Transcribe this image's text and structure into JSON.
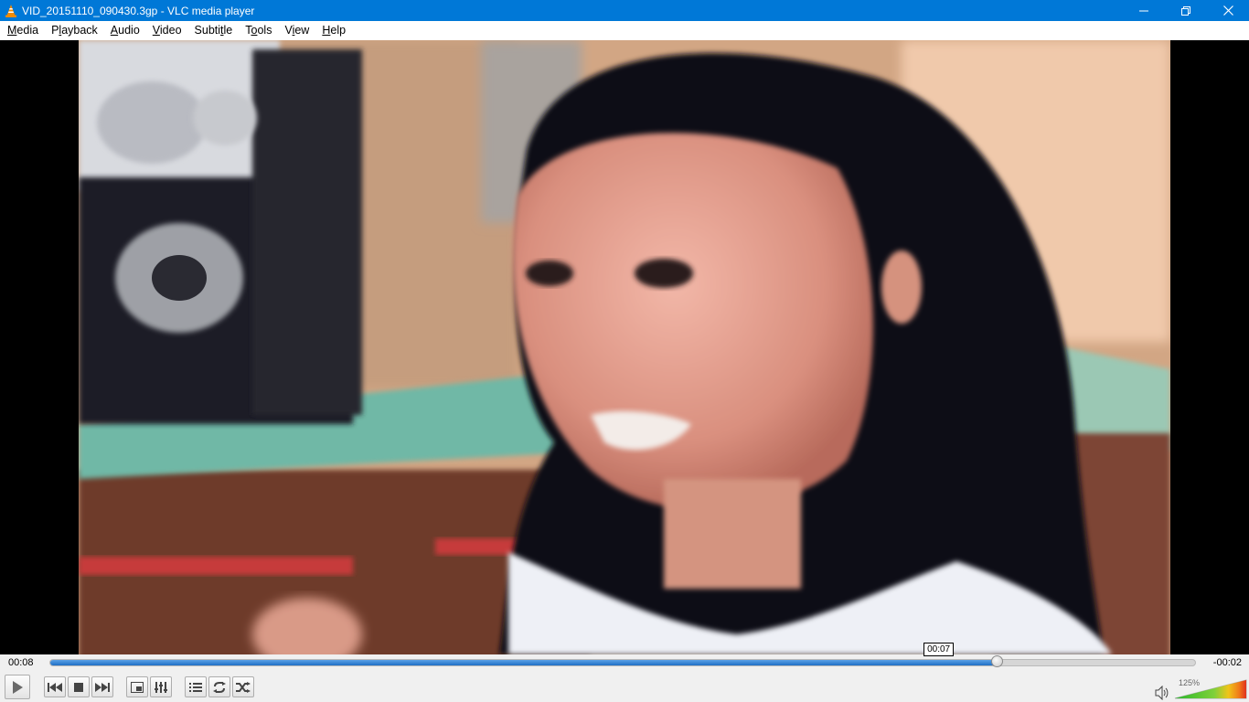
{
  "window": {
    "title": "VID_20151110_090430.3gp - VLC media player",
    "icons": [
      "vlc-cone-icon",
      "minimize-icon",
      "maximize-icon",
      "close-icon"
    ]
  },
  "menu": {
    "items": [
      {
        "pre": "",
        "acc": "M",
        "post": "edia"
      },
      {
        "pre": "P",
        "acc": "l",
        "post": "ayback"
      },
      {
        "pre": "",
        "acc": "A",
        "post": "udio"
      },
      {
        "pre": "",
        "acc": "V",
        "post": "ideo"
      },
      {
        "pre": "Subti",
        "acc": "t",
        "post": "le"
      },
      {
        "pre": "T",
        "acc": "o",
        "post": "ols"
      },
      {
        "pre": "V",
        "acc": "i",
        "post": "ew"
      },
      {
        "pre": "",
        "acc": "H",
        "post": "elp"
      }
    ]
  },
  "playback": {
    "elapsed": "00:08",
    "remaining": "-00:02",
    "progress": 0.827,
    "hover_time": "00:07",
    "hover_position": 0.776
  },
  "volume": {
    "level": "125%",
    "fraction": 1.0
  },
  "controls": {
    "icons": [
      "play-icon",
      "previous-icon",
      "stop-icon",
      "next-icon",
      "fullscreen-icon",
      "extended-settings-icon",
      "playlist-icon",
      "loop-icon",
      "shuffle-icon",
      "volume-icon"
    ]
  }
}
